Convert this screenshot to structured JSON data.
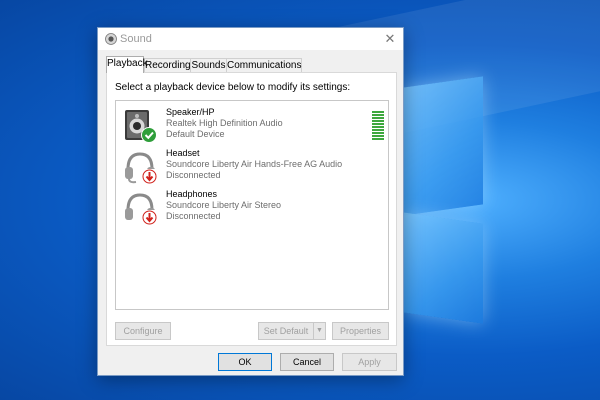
{
  "window": {
    "title": "Sound",
    "close_glyph": "✕"
  },
  "tabs": [
    {
      "label": "Playback",
      "active": true
    },
    {
      "label": "Recording",
      "active": false
    },
    {
      "label": "Sounds",
      "active": false
    },
    {
      "label": "Communications",
      "active": false
    }
  ],
  "instruction": "Select a playback device below to modify its settings:",
  "devices": [
    {
      "name": "Speaker/HP",
      "driver": "Realtek High Definition Audio",
      "status": "Default Device",
      "icon": "speaker-icon",
      "badge": "default-check-icon"
    },
    {
      "name": "Headset",
      "driver": "Soundcore Liberty Air Hands-Free AG Audio",
      "status": "Disconnected",
      "icon": "headset-icon",
      "badge": "disconnected-arrow-icon"
    },
    {
      "name": "Headphones",
      "driver": "Soundcore Liberty Air Stereo",
      "status": "Disconnected",
      "icon": "headphones-icon",
      "badge": "disconnected-arrow-icon"
    }
  ],
  "level_meter": {
    "segments": 10,
    "lit": 10,
    "color": "#3ea83e"
  },
  "buttons": {
    "configure": "Configure",
    "set_default": "Set Default",
    "properties": "Properties",
    "ok": "OK",
    "cancel": "Cancel",
    "apply": "Apply"
  },
  "colors": {
    "check_badge": "#2e9e3a",
    "disconnect_badge": "#d0201a",
    "desktop": "#0b5cc6"
  }
}
